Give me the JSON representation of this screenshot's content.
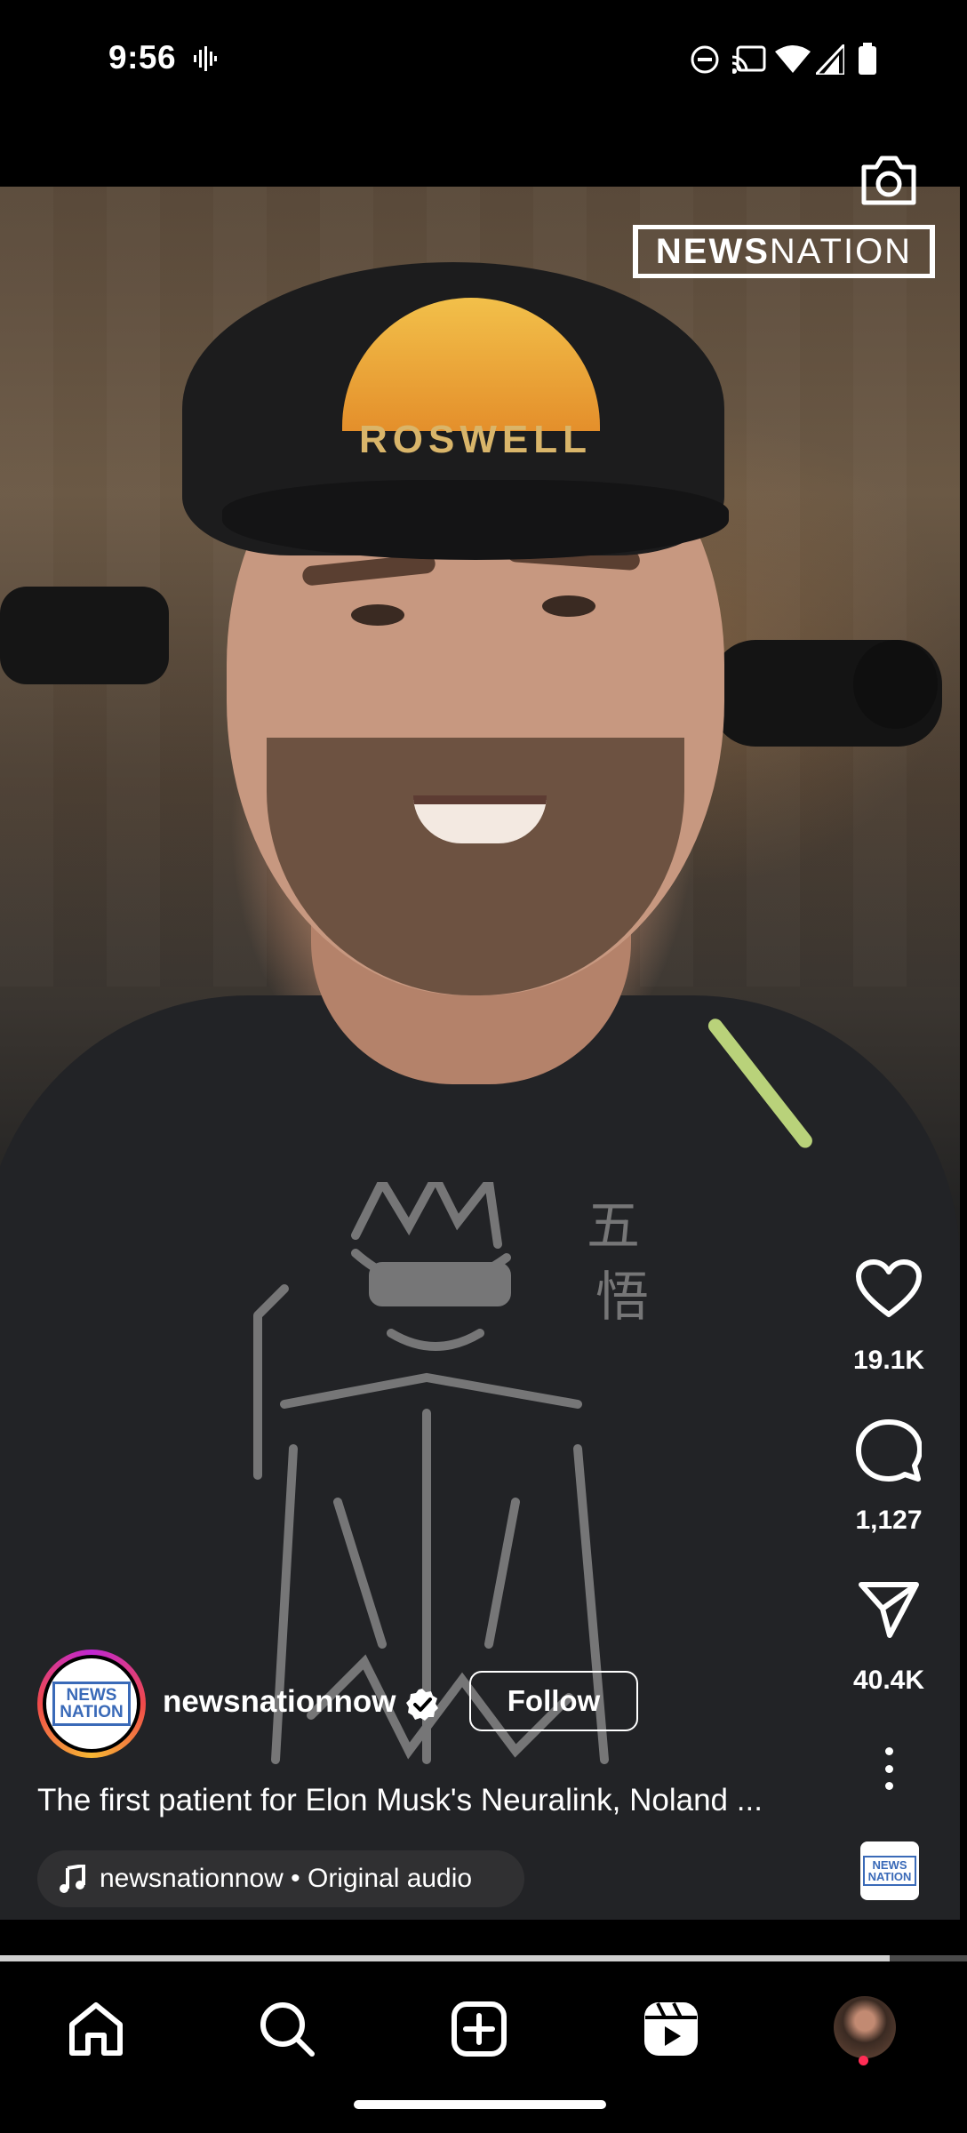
{
  "status_bar": {
    "time": "9:56",
    "icons": [
      "voicemail-waveform-icon",
      "do-not-disturb-icon",
      "cast-icon",
      "wifi-icon",
      "signal-icon",
      "battery-icon"
    ]
  },
  "video": {
    "brand_watermark_bold": "NEWS",
    "brand_watermark_light": "NATION",
    "cap_text": "ROSWELL",
    "progress_fraction": 0.92
  },
  "actions": {
    "like_count": "19.1K",
    "comment_count": "1,127",
    "share_count": "40.4K"
  },
  "post": {
    "avatar_logo_line1": "NEWS",
    "avatar_logo_line2": "NATION",
    "username": "newsnationnow",
    "follow_label": "Follow",
    "caption": "The first patient for Elon Musk's Neuralink, Noland ...",
    "audio_label": "newsnationnow • Original audio"
  },
  "bottom_nav": {
    "items": [
      "home-icon",
      "search-icon",
      "create-icon",
      "reels-icon",
      "profile-avatar"
    ]
  },
  "colors": {
    "background": "#000000",
    "notification_dot": "#ff2d55",
    "avatar_ring": [
      "#c026d3",
      "#f04a4a",
      "#f7b733"
    ]
  }
}
